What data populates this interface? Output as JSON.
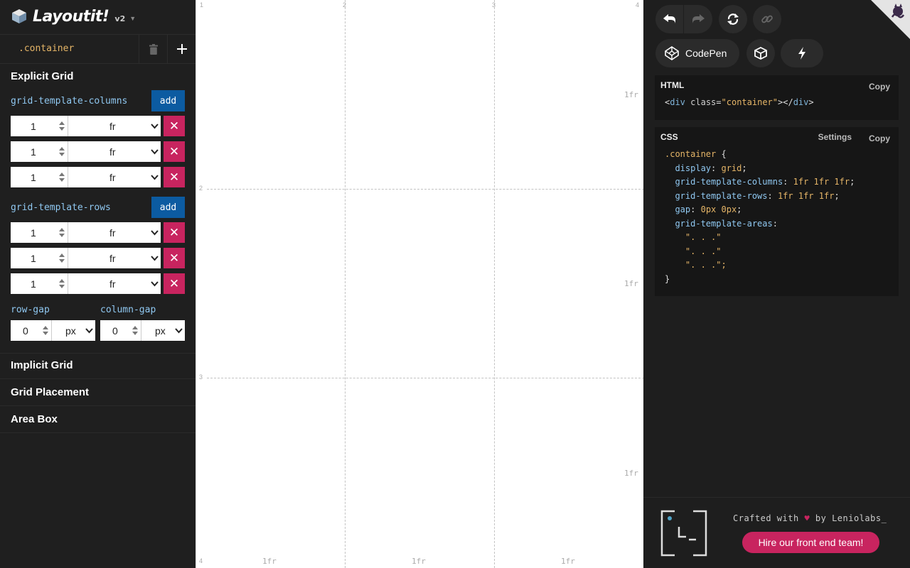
{
  "app": {
    "name": "Layoutit!",
    "version": "v2"
  },
  "container": {
    "selector": ".container"
  },
  "explicit_grid": {
    "title": "Explicit Grid",
    "columns": {
      "label": "grid-template-columns",
      "add_label": "add",
      "tracks": [
        {
          "value": "1",
          "unit": "fr"
        },
        {
          "value": "1",
          "unit": "fr"
        },
        {
          "value": "1",
          "unit": "fr"
        }
      ]
    },
    "rows": {
      "label": "grid-template-rows",
      "add_label": "add",
      "tracks": [
        {
          "value": "1",
          "unit": "fr"
        },
        {
          "value": "1",
          "unit": "fr"
        },
        {
          "value": "1",
          "unit": "fr"
        }
      ]
    },
    "row_gap": {
      "label": "row-gap",
      "value": "0",
      "unit": "px"
    },
    "column_gap": {
      "label": "column-gap",
      "value": "0",
      "unit": "px"
    }
  },
  "sections": [
    "Implicit Grid",
    "Grid Placement",
    "Area Box"
  ],
  "canvas": {
    "col_line_numbers": [
      "1",
      "2",
      "3",
      "4"
    ],
    "row_line_numbers": [
      "2",
      "3",
      "4"
    ],
    "col_track_labels": [
      "1fr",
      "1fr",
      "1fr"
    ],
    "row_track_labels": [
      "1fr",
      "1fr",
      "1fr"
    ]
  },
  "toolbar": {
    "codepen_label": "CodePen",
    "icons": [
      "undo-icon",
      "redo-icon",
      "reset-icon",
      "link-icon",
      "codepen-icon",
      "codesandbox-icon",
      "lightning-icon",
      "github-icon"
    ]
  },
  "html_panel": {
    "title": "HTML",
    "copy_label": "Copy",
    "code": {
      "open_tag": "div",
      "attr": "class",
      "attr_value": "\"container\"",
      "close_tag": "div"
    }
  },
  "css_panel": {
    "title": "CSS",
    "settings_label": "Settings",
    "copy_label": "Copy",
    "selector": ".container",
    "declarations": [
      {
        "prop": "display",
        "value": "grid"
      },
      {
        "prop": "grid-template-columns",
        "value": "1fr 1fr 1fr"
      },
      {
        "prop": "grid-template-rows",
        "value": "1fr 1fr 1fr"
      },
      {
        "prop": "gap",
        "value": "0px 0px"
      },
      {
        "prop": "grid-template-areas",
        "value": ""
      }
    ],
    "areas": [
      "\". . .\"",
      "\". . .\"",
      "\". . .\";"
    ]
  },
  "footer": {
    "crafted_prefix": "Crafted with",
    "heart": "♥",
    "crafted_suffix": "by Leniolabs_",
    "hire_label": "Hire our front end team!"
  },
  "colors": {
    "accent_pink": "#c8245f",
    "add_blue": "#0c5ba1",
    "label_blue": "#8fc7f0",
    "code_orange": "#e5b567"
  }
}
